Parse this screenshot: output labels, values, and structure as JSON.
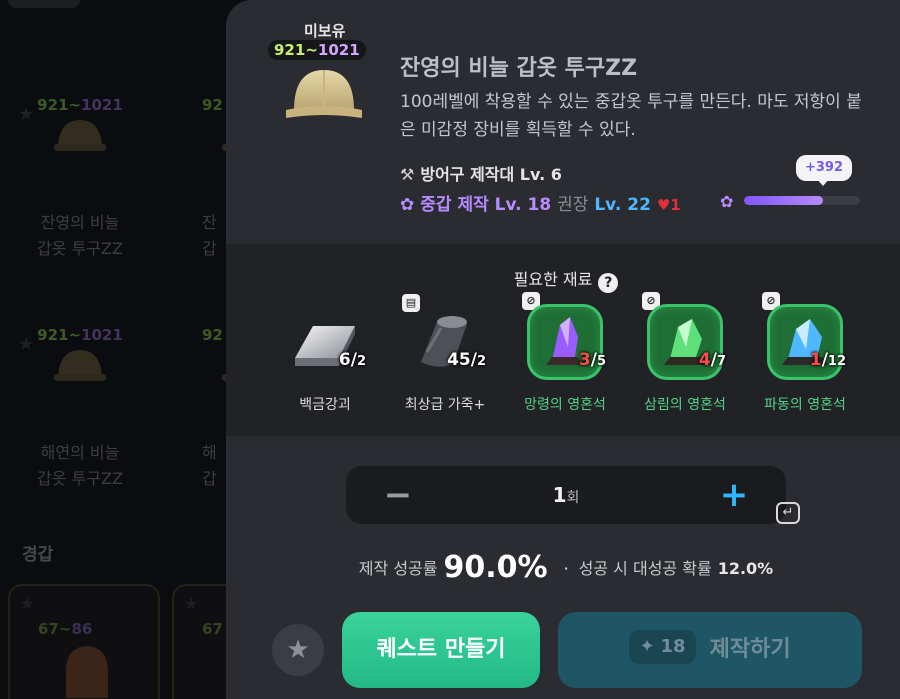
{
  "colors": {
    "accent_purple": "#b78bff",
    "quest_green": "#2fca92",
    "craft_teal": "#1f5666",
    "shortage_red": "#ff4a4a",
    "plus_blue": "#2fb8ff"
  },
  "background_list": {
    "cards": [
      {
        "lv_from": "921",
        "lv_sep": "~",
        "lv_to": "1021",
        "name_line1": "잔영의 비늘",
        "name_line2": "갑옷 투구ZZ"
      },
      {
        "lv_from": "92",
        "name_line1": "잔",
        "name_line2": "갑"
      },
      {
        "lv_from": "921",
        "lv_sep": "~",
        "lv_to": "1021",
        "name_line1": "해연의 비늘",
        "name_line2": "갑옷 투구ZZ"
      },
      {
        "lv_from": "92",
        "name_line1": "해",
        "name_line2": "갑"
      }
    ],
    "section_title": "경갑",
    "mini_cards": [
      {
        "lv_from": "67",
        "lv_sep": "~",
        "lv_to": "86"
      },
      {
        "lv_from": "67"
      }
    ]
  },
  "item": {
    "owned_label": "미보유",
    "lv_from": "921",
    "lv_sep": "~",
    "lv_to": "1021",
    "icon": "helmet-icon",
    "title": "잔영의 비늘 갑옷 투구ZZ",
    "description": "100레벨에 착용할 수 있는 중갑옷 투구를 만든다. 마도 저항이 붙은 미감정 장비를 획득할 수 있다.",
    "station": "방어구 제작대 Lv. 6",
    "skill": "중갑 제작 Lv. 18",
    "recommend_label": "권장",
    "recommend_value": "Lv. 22",
    "recommend_diff": "1",
    "xp_gain": "+392",
    "xp_progress": 0.68
  },
  "materials": {
    "title": "필요한 재료",
    "items": [
      {
        "name": "백금강괴",
        "have": "6",
        "req": "2",
        "icon": "ingot-icon"
      },
      {
        "name": "최상급 가죽+",
        "have": "45",
        "req": "2",
        "icon": "leather-roll-icon"
      },
      {
        "name": "망령의 영혼석",
        "have": "3",
        "req": "5",
        "icon": "purple-crystal-icon"
      },
      {
        "name": "삼림의 영혼석",
        "have": "4",
        "req": "7",
        "icon": "green-crystal-icon"
      },
      {
        "name": "파동의 영혼석",
        "have": "1",
        "req": "12",
        "icon": "blue-crystal-icon"
      }
    ]
  },
  "quantity": {
    "value": "1",
    "unit": "회"
  },
  "rates": {
    "success_label": "제작 성공률",
    "success_value": "90.0%",
    "great_label": "성공 시 대성공 확률",
    "great_value": "12.0%"
  },
  "buttons": {
    "quest": "퀘스트 만들기",
    "craft": "제작하기",
    "craft_cost": "18"
  }
}
